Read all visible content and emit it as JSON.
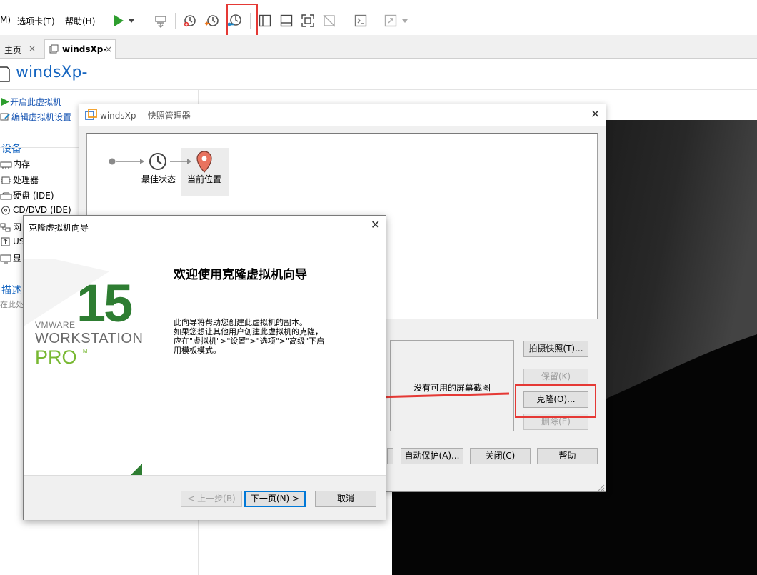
{
  "colors": {
    "accent_blue": "#1565c0",
    "vmware_green": "#2e7d32",
    "pro_green": "#78b832",
    "highlight_red": "#e53935",
    "console_black": "#050505"
  },
  "toolbar": {
    "menu_vm_partial": "M)",
    "menu_tabs": "选项卡(T)",
    "menu_help": "帮助(H)",
    "icons": [
      "play-icon",
      "dropdown-icon",
      "send-keys-icon",
      "snapshot-icon",
      "revert-snapshot-icon",
      "snapshot-manager-icon",
      "library-view-icon",
      "thumbnail-bar-icon",
      "fullscreen-icon",
      "unity-icon",
      "console-icon",
      "stretch-icon"
    ]
  },
  "tabs": {
    "home": "主页",
    "vm": "windsXp-",
    "close_glyph": "×"
  },
  "page": {
    "title": "windsXp-"
  },
  "left_panel": {
    "power_on": "开启此虚拟机",
    "edit_settings": "编辑虚拟机设置",
    "devices_title": "设备",
    "devices": [
      "内存",
      "处理器",
      "硬盘 (IDE)",
      "CD/DVD (IDE)",
      "网",
      "US",
      "显"
    ],
    "description_title": "描述",
    "description_partial": "在此处"
  },
  "snapshot_manager": {
    "title": "windsXp- - 快照管理器",
    "nodes": {
      "best_state": "最佳状态",
      "current_location": "当前位置"
    },
    "no_screenshot": "没有可用的屏幕截图",
    "buttons": {
      "take_snapshot": "拍摄快照(T)...",
      "keep": "保留(K)",
      "clone": "克隆(O)...",
      "delete": "删除(E)",
      "auto_protect": "自动保护(A)...",
      "close": "关闭(C)",
      "help": "帮助"
    }
  },
  "clone_wizard": {
    "title": "克隆虚拟机向导",
    "heading": "欢迎使用克隆虚拟机向导",
    "description_lines": [
      "此向导将帮助您创建此虚拟机的副本。",
      "如果您想让其他用户创建此虚拟机的克隆，",
      "应在\"虚拟机\">\"设置\">\"选项\">\"高级\"下启",
      "用模板模式。"
    ],
    "logo": {
      "version": "15",
      "vmware": "VMWARE",
      "workstation": "WORKSTATION",
      "pro": "PRO",
      "tm": "TM"
    },
    "buttons": {
      "back": "< 上一步(B)",
      "next": "下一页(N) >",
      "cancel": "取消"
    }
  }
}
